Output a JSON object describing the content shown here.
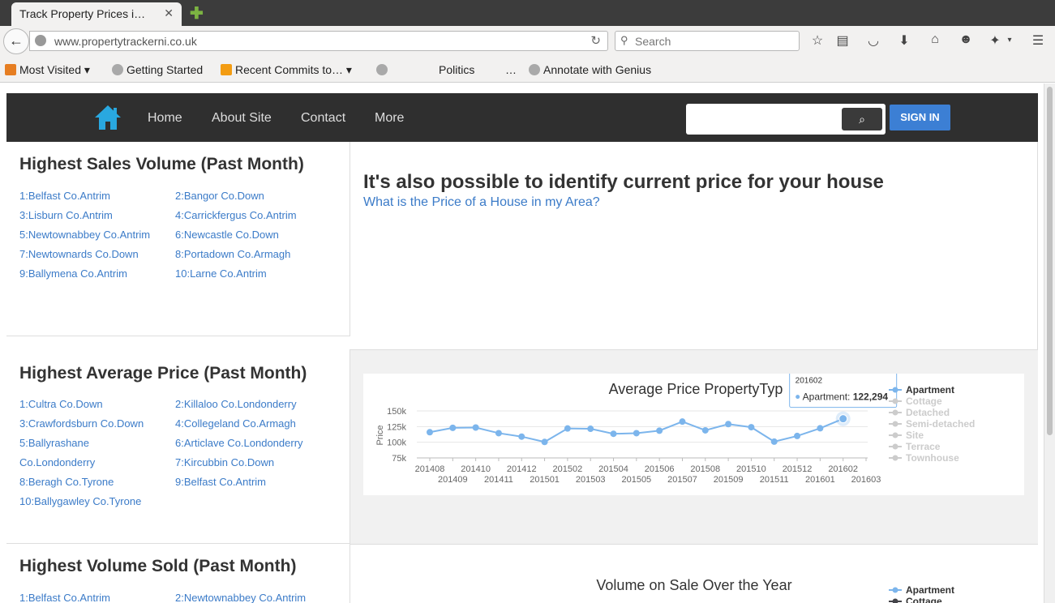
{
  "browser": {
    "tab_title": "Track Property Prices i…",
    "tab_close": "✕",
    "new_tab": "✚",
    "back_glyph": "←",
    "url": "www.propertytrackerni.co.uk",
    "search_placeholder": "Search",
    "bookmarks": [
      {
        "label": "Most Visited ▾",
        "icon": "most-visited-icon"
      },
      {
        "label": "Getting Started",
        "icon": "globe-icon"
      },
      {
        "label": "Recent Commits to… ▾",
        "icon": "rss-icon"
      },
      {
        "label": "",
        "icon": "globe-icon"
      },
      {
        "label": "Politics",
        "icon": "none"
      },
      {
        "label": "…",
        "icon": "none"
      },
      {
        "label": "Annotate with Genius",
        "icon": "globe-icon"
      }
    ]
  },
  "site": {
    "nav": [
      "Home",
      "About Site",
      "Contact",
      "More"
    ],
    "signin": "SIGN IN",
    "search_glyph": "⌕"
  },
  "sales_volume": {
    "title": "Highest Sales Volume (Past Month)",
    "items": [
      "1:Belfast Co.Antrim",
      "2:Bangor Co.Down",
      "3:Lisburn Co.Antrim",
      "4:Carrickfergus Co.Antrim",
      "5:Newtownabbey Co.Antrim",
      "6:Newcastle Co.Down",
      "7:Newtownards Co.Down",
      "8:Portadown Co.Armagh",
      "9:Ballymena Co.Antrim",
      "10:Larne Co.Antrim"
    ]
  },
  "price_promo": {
    "heading": "It's also possible to identify current price for your house",
    "link": "What is the Price of a House in my Area?"
  },
  "avg_price": {
    "title": "Highest Average Price (Past Month)",
    "items": [
      "1:Cultra Co.Down",
      "2:Killaloo Co.Londonderry",
      "3:Crawfordsburn Co.Down",
      "4:Collegeland Co.Armagh",
      "5:Ballyrashane",
      "6:Articlave Co.Londonderry",
      "Co.Londonderry",
      "7:Kircubbin Co.Down",
      "8:Beragh Co.Tyrone",
      "9:Belfast Co.Antrim",
      "10:Ballygawley Co.Tyrone"
    ]
  },
  "volume_sold": {
    "title": "Highest Volume Sold (Past Month)",
    "items": [
      "1:Belfast Co.Antrim",
      "2:Newtownabbey Co.Antrim"
    ]
  },
  "tooltip": {
    "period": "201602",
    "label": "Apartment: ",
    "value": "122,294"
  },
  "chart_data": [
    {
      "type": "line",
      "title": "Average Price PropertyTyp",
      "ylabel": "Price",
      "xlabel": "",
      "ylim": [
        75000,
        150000
      ],
      "yticks": [
        "150k",
        "125k",
        "100k",
        "75k"
      ],
      "x": [
        "201408",
        "201409",
        "201410",
        "201411",
        "201412",
        "201501",
        "201502",
        "201503",
        "201504",
        "201505",
        "201506",
        "201507",
        "201508",
        "201509",
        "201510",
        "201511",
        "201512",
        "201601",
        "201602",
        "201603"
      ],
      "series": [
        {
          "name": "Apartment",
          "values": [
            116000,
            123000,
            123500,
            114500,
            109000,
            100500,
            122000,
            121500,
            113500,
            114500,
            118500,
            133000,
            119000,
            129000,
            124000,
            101000,
            110000,
            122294,
            137500,
            null
          ],
          "color": "#7cb5ec"
        },
        {
          "name": "Cottage",
          "values": [],
          "hidden": true
        },
        {
          "name": "Detached",
          "values": [],
          "hidden": true
        },
        {
          "name": "Semi-detached",
          "values": [],
          "hidden": true
        },
        {
          "name": "Site",
          "values": [],
          "hidden": true
        },
        {
          "name": "Terrace",
          "values": [],
          "hidden": true
        },
        {
          "name": "Townhouse",
          "values": [],
          "hidden": true
        }
      ],
      "legend": "right"
    },
    {
      "type": "line",
      "title": "Volume on Sale Over the Year",
      "series": [
        {
          "name": "Apartment",
          "values": [],
          "color": "#7cb5ec"
        },
        {
          "name": "Cottage",
          "values": [],
          "color": "#434348"
        }
      ],
      "legend": "right"
    }
  ]
}
